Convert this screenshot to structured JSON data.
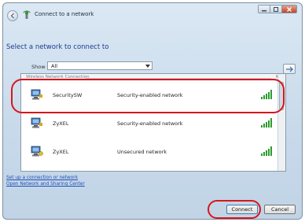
{
  "window": {
    "title": "Connect to a network",
    "caption_buttons": [
      "minimize",
      "maximize",
      "close"
    ]
  },
  "main": {
    "heading": "Select a network to connect to",
    "show_label": "Show",
    "show_value": "All",
    "group_header": "Wireless Network Connection",
    "group_close": "×",
    "networks": [
      {
        "name": "SecuritySW",
        "security": "Security-enabled network",
        "icon": "secured-network-icon",
        "signal": "signal-bars-icon"
      },
      {
        "name": "ZyXEL",
        "security": "Security-enabled network",
        "icon": "secured-network-icon",
        "signal": "signal-bars-icon"
      },
      {
        "name": "ZyXEL",
        "security": "Unsecured network",
        "icon": "unsecured-network-icon",
        "signal": "signal-bars-icon"
      }
    ],
    "links": [
      "Set up a connection or network",
      "Open Network and Sharing Center"
    ]
  },
  "buttons": {
    "connect": "Connect",
    "cancel": "Cancel"
  },
  "colors": {
    "heading": "#1e3c8e",
    "link": "#1f4fb5",
    "highlight": "#d8161b",
    "signal": "#2e9a2e"
  }
}
